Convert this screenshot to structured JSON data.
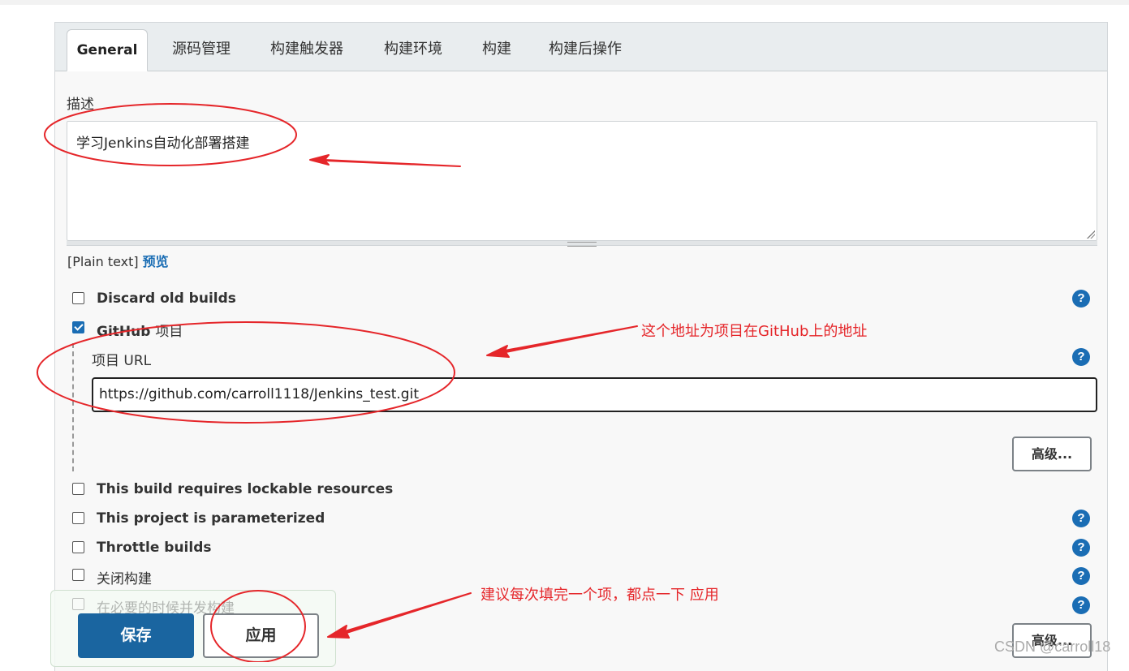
{
  "tabs": [
    {
      "label": "General",
      "active": true
    },
    {
      "label": "源码管理"
    },
    {
      "label": "构建触发器"
    },
    {
      "label": "构建环境"
    },
    {
      "label": "构建"
    },
    {
      "label": "构建后操作"
    }
  ],
  "description": {
    "label": "描述",
    "value": "学习Jenkins自动化部署搭建",
    "format_label": "[Plain text]",
    "preview_link": "预览"
  },
  "options": {
    "discard_old_builds": {
      "label": "Discard old builds",
      "checked": false
    },
    "github_project": {
      "label_en": "GitHub",
      "label_cn": "项目",
      "checked": true
    },
    "project_url_label": "项目 URL",
    "project_url_value": "https://github.com/carroll1118/Jenkins_test.git",
    "advanced_label": "高级...",
    "lockable_resources": {
      "label": "This build requires lockable resources",
      "checked": false
    },
    "parameterized": {
      "label": "This project is parameterized",
      "checked": false
    },
    "throttle_builds": {
      "label": "Throttle builds",
      "checked": false
    },
    "disable_build": {
      "label": "关闭构建",
      "checked": false
    },
    "concurrent_builds": {
      "label": "在必要的时候并发构建",
      "checked": false
    },
    "advanced_label_2": "高级..."
  },
  "footer": {
    "save_label": "保存",
    "apply_label": "应用"
  },
  "annotations": {
    "github_note": "这个地址为项目在GitHub上的地址",
    "apply_note": "建议每次填完一个项，都点一下 应用"
  },
  "watermark": "CSDN @carroll18",
  "colors": {
    "accent": "#1a6db4",
    "annotation_red": "#e5262a",
    "panel_bg": "#f8f8f8"
  },
  "icons": {
    "help": "question-circle-icon",
    "checkbox": "checkbox-icon"
  }
}
